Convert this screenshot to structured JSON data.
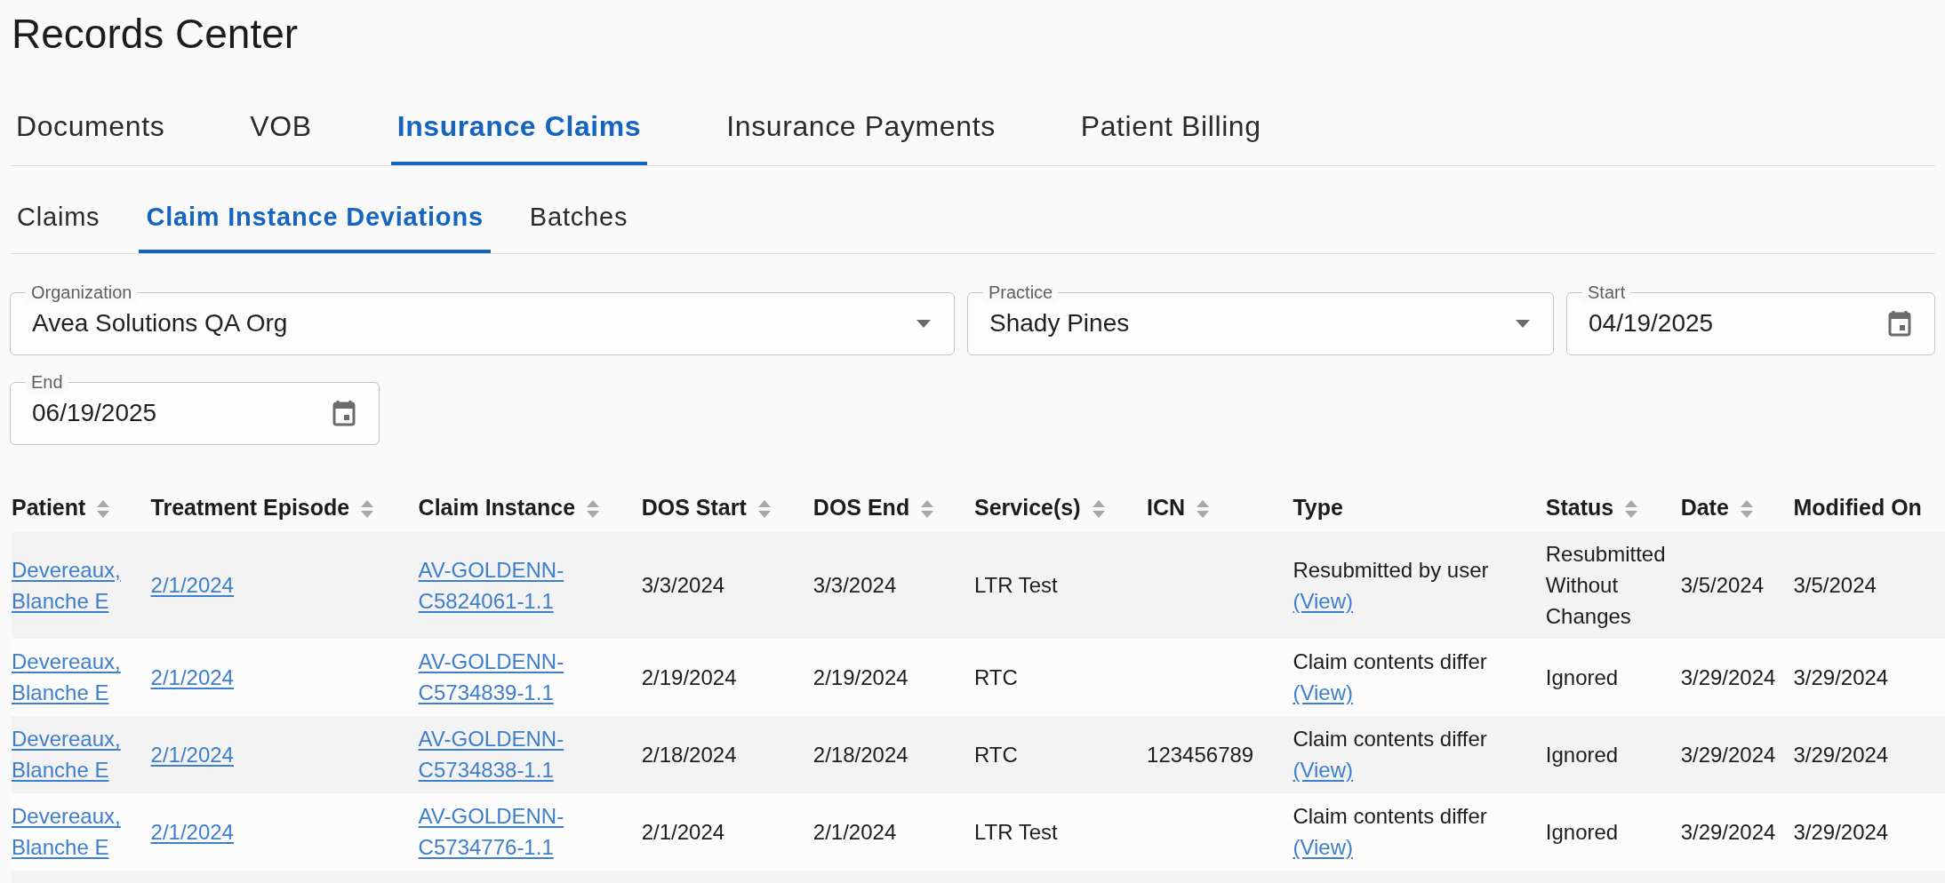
{
  "page_title": "Records Center",
  "tabs": [
    {
      "label": "Documents",
      "selected": false
    },
    {
      "label": "VOB",
      "selected": false
    },
    {
      "label": "Insurance Claims",
      "selected": true
    },
    {
      "label": "Insurance Payments",
      "selected": false
    },
    {
      "label": "Patient Billing",
      "selected": false
    }
  ],
  "subtabs": [
    {
      "label": "Claims",
      "selected": false
    },
    {
      "label": "Claim Instance Deviations",
      "selected": true
    },
    {
      "label": "Batches",
      "selected": false
    }
  ],
  "filters": [
    {
      "kind": "select",
      "label": "Organization",
      "value": "Avea Solutions QA Org"
    },
    {
      "kind": "select",
      "label": "Practice",
      "value": "Shady Pines"
    },
    {
      "kind": "date",
      "label": "Start",
      "value": "04/19/2025"
    },
    {
      "kind": "date",
      "label": "End",
      "value": "06/19/2025"
    }
  ],
  "table": {
    "columns": [
      {
        "label": "Patient",
        "sortable": true
      },
      {
        "label": "Treatment Episode",
        "sortable": true
      },
      {
        "label": "Claim Instance",
        "sortable": true
      },
      {
        "label": "DOS Start",
        "sortable": true
      },
      {
        "label": "DOS End",
        "sortable": true
      },
      {
        "label": "Service(s)",
        "sortable": true
      },
      {
        "label": "ICN",
        "sortable": true
      },
      {
        "label": "Type",
        "sortable": false
      },
      {
        "label": "Status",
        "sortable": true
      },
      {
        "label": "Date",
        "sortable": true
      },
      {
        "label": "Modified On",
        "sortable": false
      }
    ],
    "rows": [
      {
        "patient": "Devereaux, Blanche E",
        "treatment_episode": "2/1/2024",
        "claim_instance": "AV-GOLDENN-C5824061-1.1",
        "dos_start": "3/3/2024",
        "dos_end": "3/3/2024",
        "services": "LTR Test",
        "type": "Resubmitted by user",
        "type_link": "(View)",
        "status": "Resubmitted Without Changes",
        "date": "3/5/2024",
        "modified_on": "3/5/2024"
      },
      {
        "patient": "Devereaux, Blanche E",
        "treatment_episode": "2/1/2024",
        "claim_instance": "AV-GOLDENN-C5734839-1.1",
        "dos_start": "2/19/2024",
        "dos_end": "2/19/2024",
        "services": "RTC",
        "type": "Claim contents differ",
        "type_link": "(View)",
        "status": "Ignored",
        "date": "3/29/2024",
        "modified_on": "3/29/2024"
      },
      {
        "patient": "Devereaux, Blanche E",
        "treatment_episode": "2/1/2024",
        "claim_instance": "AV-GOLDENN-C5734838-1.1",
        "dos_start": "2/18/2024",
        "dos_end": "2/18/2024",
        "services": "RTC",
        "icn": "123456789",
        "type": "Claim contents differ",
        "type_link": "(View)",
        "status": "Ignored",
        "date": "3/29/2024",
        "modified_on": "3/29/2024"
      },
      {
        "patient": "Devereaux, Blanche E",
        "treatment_episode": "2/1/2024",
        "claim_instance": "AV-GOLDENN-C5734776-1.1",
        "dos_start": "2/1/2024",
        "dos_end": "2/1/2024",
        "services": "LTR Test",
        "type": "Claim contents differ",
        "type_link": "(View)",
        "status": "Ignored",
        "date": "3/29/2024",
        "modified_on": "3/29/2024"
      }
    ]
  }
}
